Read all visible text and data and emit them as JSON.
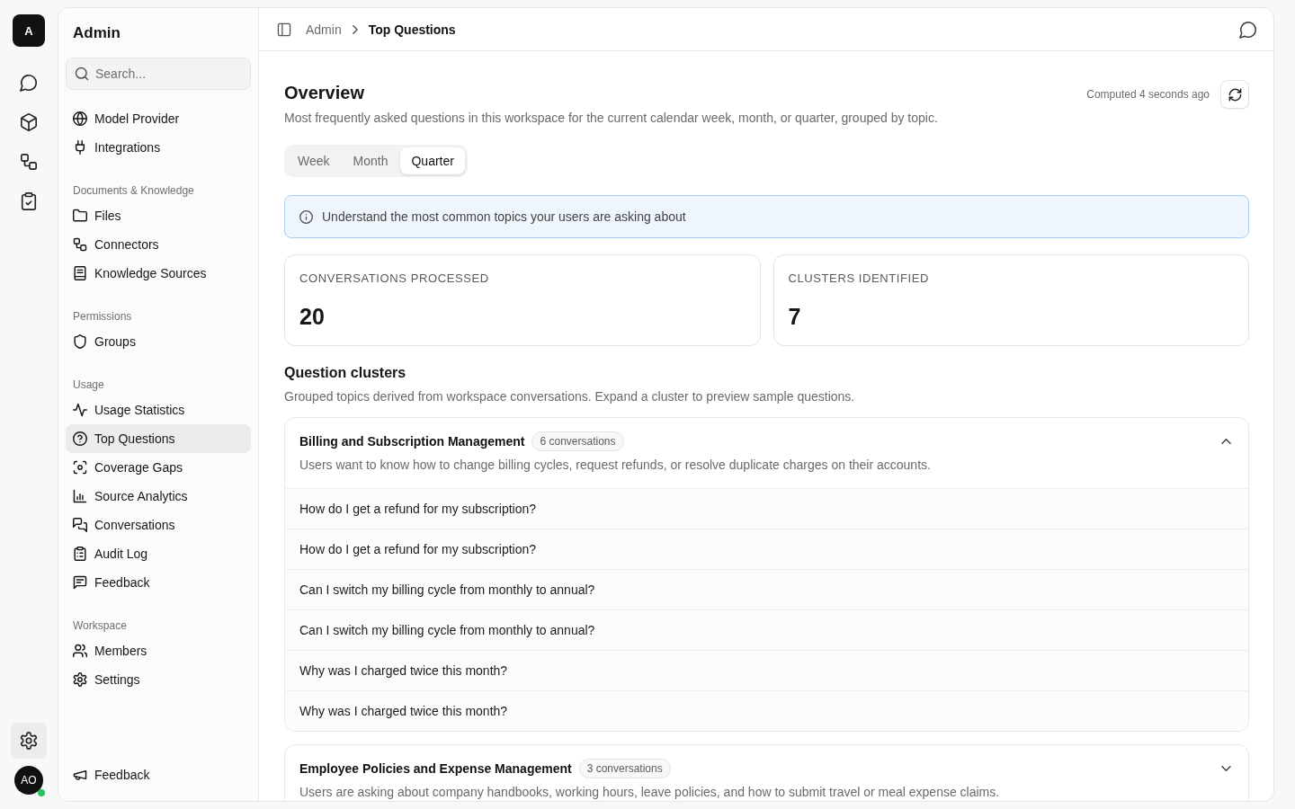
{
  "rail": {
    "logo": "A",
    "items": [
      {
        "selected": false
      },
      {
        "selected": false
      },
      {
        "selected": false
      },
      {
        "selected": false
      }
    ],
    "settings_button": {
      "selected": true
    },
    "avatar": {
      "initials": "AO",
      "online": true
    }
  },
  "sidebar": {
    "title": "Admin",
    "search": {
      "placeholder": "Search..."
    },
    "sections": [
      {
        "items": [
          {
            "label": "Model Provider",
            "selected": false
          },
          {
            "label": "Integrations",
            "selected": false
          }
        ]
      },
      {
        "heading": "Documents & Knowledge",
        "items": [
          {
            "label": "Files",
            "selected": false
          },
          {
            "label": "Connectors",
            "selected": false
          },
          {
            "label": "Knowledge Sources",
            "selected": false
          }
        ]
      },
      {
        "heading": "Permissions",
        "items": [
          {
            "label": "Groups",
            "selected": false
          }
        ]
      },
      {
        "heading": "Usage",
        "items": [
          {
            "label": "Usage Statistics",
            "selected": false
          },
          {
            "label": "Top Questions",
            "selected": true
          },
          {
            "label": "Coverage Gaps",
            "selected": false
          },
          {
            "label": "Source Analytics",
            "selected": false
          },
          {
            "label": "Conversations",
            "selected": false
          },
          {
            "label": "Audit Log",
            "selected": false
          },
          {
            "label": "Feedback",
            "selected": false
          }
        ]
      },
      {
        "heading": "Workspace",
        "items": [
          {
            "label": "Members",
            "selected": false
          },
          {
            "label": "Settings",
            "selected": false
          }
        ]
      }
    ],
    "footer": {
      "label": "Feedback"
    }
  },
  "header": {
    "breadcrumb": [
      {
        "label": "Admin",
        "current": false
      },
      {
        "label": "Top Questions",
        "current": true
      }
    ]
  },
  "overview": {
    "title": "Overview",
    "description": "Most frequently asked questions in this workspace for the current calendar week, month, or quarter, grouped by topic.",
    "computed": "Computed 4 seconds ago",
    "periods": [
      {
        "label": "Week",
        "selected": false
      },
      {
        "label": "Month",
        "selected": false
      },
      {
        "label": "Quarter",
        "selected": true
      }
    ],
    "info": "Understand the most common topics your users are asking about"
  },
  "stats": [
    {
      "label": "CONVERSATIONS PROCESSED",
      "value": "20"
    },
    {
      "label": "CLUSTERS IDENTIFIED",
      "value": "7"
    }
  ],
  "clusters": {
    "title": "Question clusters",
    "description": "Grouped topics derived from workspace conversations. Expand a cluster to preview sample questions.",
    "items": [
      {
        "title": "Billing and Subscription Management",
        "count": "6 conversations",
        "description": "Users want to know how to change billing cycles, request refunds, or resolve duplicate charges on their accounts.",
        "expanded": true,
        "questions": [
          "How do I get a refund for my subscription?",
          "How do I get a refund for my subscription?",
          "Can I switch my billing cycle from monthly to annual?",
          "Can I switch my billing cycle from monthly to annual?",
          "Why was I charged twice this month?",
          "Why was I charged twice this month?"
        ]
      },
      {
        "title": "Employee Policies and Expense Management",
        "count": "3 conversations",
        "description": "Users are asking about company handbooks, working hours, leave policies, and how to submit travel or meal expense claims.",
        "expanded": false
      }
    ]
  }
}
